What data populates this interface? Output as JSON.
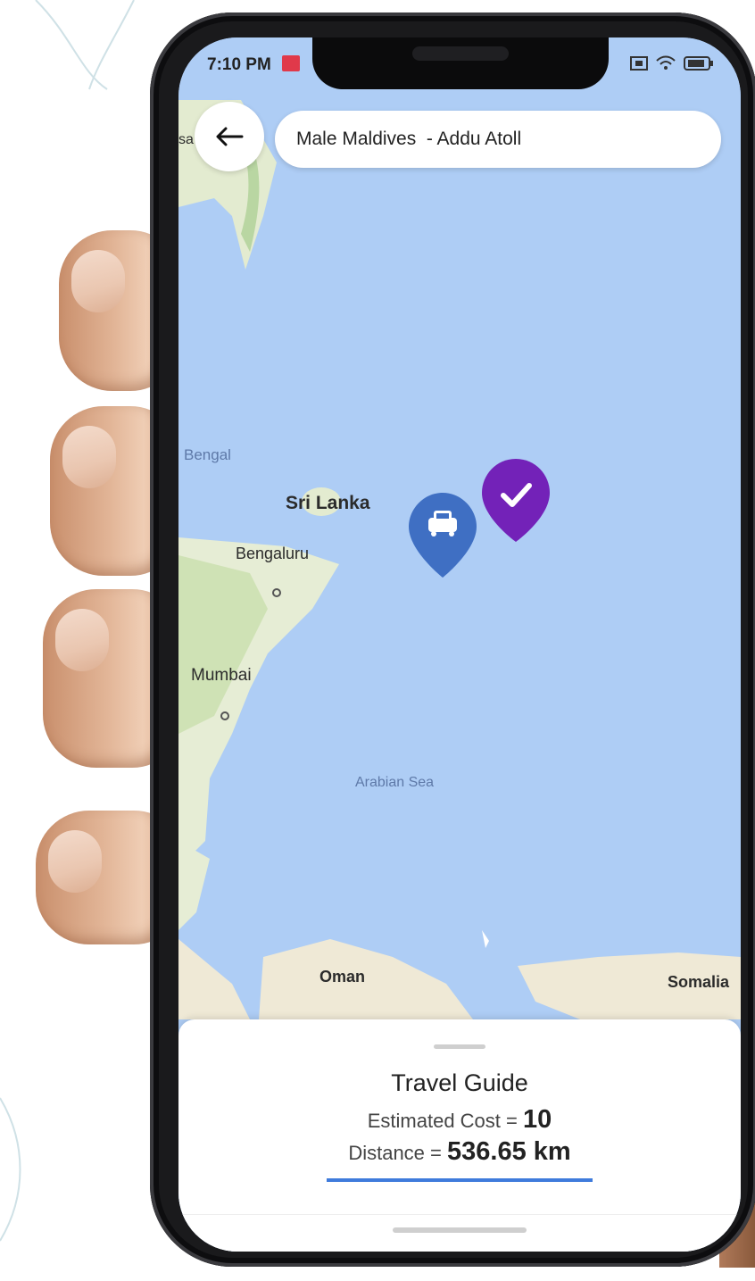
{
  "status_bar": {
    "time": "7:10 PM"
  },
  "search": {
    "route_text": "Male Maldives  - Addu Atoll"
  },
  "map": {
    "labels": {
      "sri_lanka": "Sri Lanka",
      "bengaluru": "Bengaluru",
      "mumbai": "Mumbai",
      "arabian_sea": "Arabian Sea",
      "oman": "Oman",
      "somalia": "Somalia",
      "bengal": "Bengal",
      "sa": "sa"
    },
    "colors": {
      "sea": "#aecdf5",
      "land": "#e9efdc",
      "taxi_pin": "#3f6fc3",
      "destination_pin": "#7322b8"
    }
  },
  "sheet": {
    "title": "Travel Guide",
    "cost_label": "Estimated Cost = ",
    "cost_value": "10",
    "distance_label": "Distance = ",
    "distance_value": "536.65 km",
    "progress_fraction": 1.0
  },
  "icons": [
    "back-arrow-icon",
    "taxi-icon",
    "check-icon",
    "wifi-icon",
    "battery-icon",
    "sim-icon"
  ]
}
